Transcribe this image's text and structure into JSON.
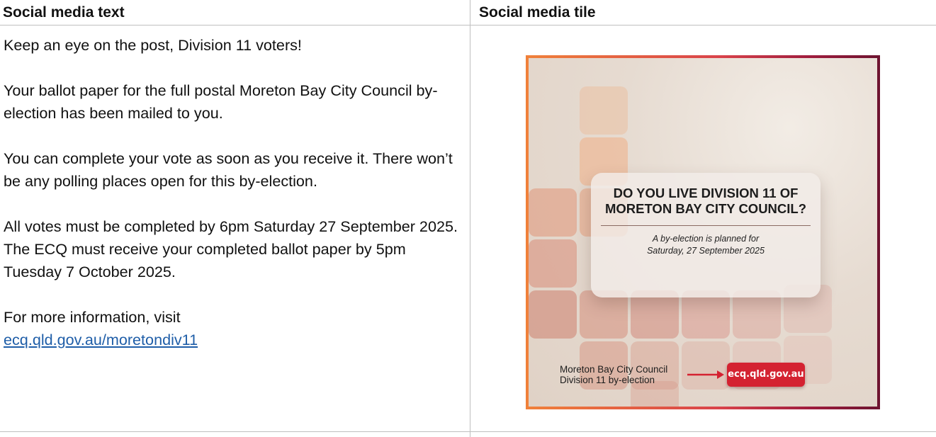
{
  "table": {
    "header_left": "Social media text",
    "header_right": "Social media tile"
  },
  "post": {
    "para1": "Keep an eye on the post, Division 11 voters!",
    "para2": "Your ballot paper for the full postal Moreton Bay City Council by-election has been mailed to you.",
    "para3": "You can complete your vote as soon as you receive it. There won’t be any polling places open for this by-election.",
    "para4": "All votes must be completed by 6pm Saturday 27 September 2025. The ECQ must receive your completed ballot paper by 5pm Tuesday 7 October 2025.",
    "para5_prefix": "For more information, visit",
    "link_text": "ecq.qld.gov.au/moretondiv11"
  },
  "tile": {
    "card_title": "DO YOU LIVE DIVISION 11 OF MORETON BAY CITY COUNCIL?",
    "card_sub_line1": "A by-election is planned for",
    "card_sub_line2": "Saturday, 27 September 2025",
    "footer_line1": "Moreton Bay City Council",
    "footer_line2": "Division 11 by-election",
    "url_button": "ecq.qld.gov.au",
    "colors": {
      "border_start": "#f0813a",
      "border_end": "#6d1430",
      "button": "#d42231",
      "arrow": "#d42231"
    }
  }
}
